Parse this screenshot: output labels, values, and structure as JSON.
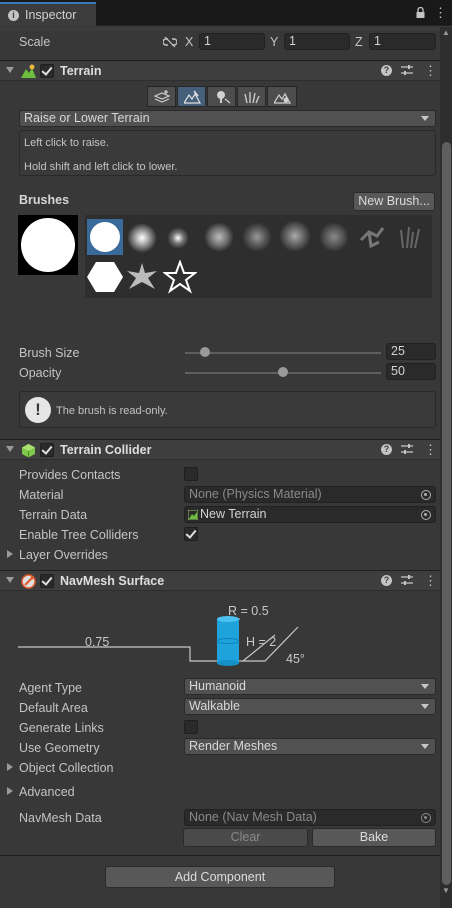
{
  "window": {
    "tab_title": "Inspector"
  },
  "transform": {
    "scale_label": "Scale",
    "x_label": "X",
    "x_value": "1",
    "y_label": "Y",
    "y_value": "1",
    "z_label": "Z",
    "z_value": "1"
  },
  "terrain": {
    "title": "Terrain",
    "enabled": true,
    "tool_dropdown": "Raise or Lower Terrain",
    "help_line1": "Left click to raise.",
    "help_line2": "Hold shift and left click to lower.",
    "brushes_label": "Brushes",
    "new_brush_button": "New Brush...",
    "brush_size_label": "Brush Size",
    "brush_size_value": "25",
    "brush_size_fraction": 0.1,
    "opacity_label": "Opacity",
    "opacity_value": "50",
    "opacity_fraction": 0.5,
    "readonly_message": "The brush is read-only."
  },
  "terrain_collider": {
    "title": "Terrain Collider",
    "enabled": true,
    "provides_contacts_label": "Provides Contacts",
    "provides_contacts": false,
    "material_label": "Material",
    "material_value": "None (Physics Material)",
    "terrain_data_label": "Terrain Data",
    "terrain_data_value": "New Terrain",
    "enable_tree_colliders_label": "Enable Tree Colliders",
    "enable_tree_colliders": true,
    "layer_overrides_label": "Layer Overrides"
  },
  "navmesh_surface": {
    "title": "NavMesh Surface",
    "enabled": true,
    "diagram": {
      "radius_label": "R = 0.5",
      "height_label": "H = 2",
      "step_label": "0.75",
      "slope_label": "45°"
    },
    "agent_type_label": "Agent Type",
    "agent_type_value": "Humanoid",
    "default_area_label": "Default Area",
    "default_area_value": "Walkable",
    "generate_links_label": "Generate Links",
    "generate_links": false,
    "use_geometry_label": "Use Geometry",
    "use_geometry_value": "Render Meshes",
    "object_collection_label": "Object Collection",
    "advanced_label": "Advanced",
    "navmesh_data_label": "NavMesh Data",
    "navmesh_data_value": "None (Nav Mesh Data)",
    "clear_button": "Clear",
    "bake_button": "Bake"
  },
  "footer": {
    "add_component_button": "Add Component"
  },
  "colors": {
    "background": "#383838",
    "field": "#2a2a2a",
    "accent_tab": "#3a79bb",
    "active_tool": "#46607c",
    "navmesh_cylinder": "#1fa3dd"
  }
}
